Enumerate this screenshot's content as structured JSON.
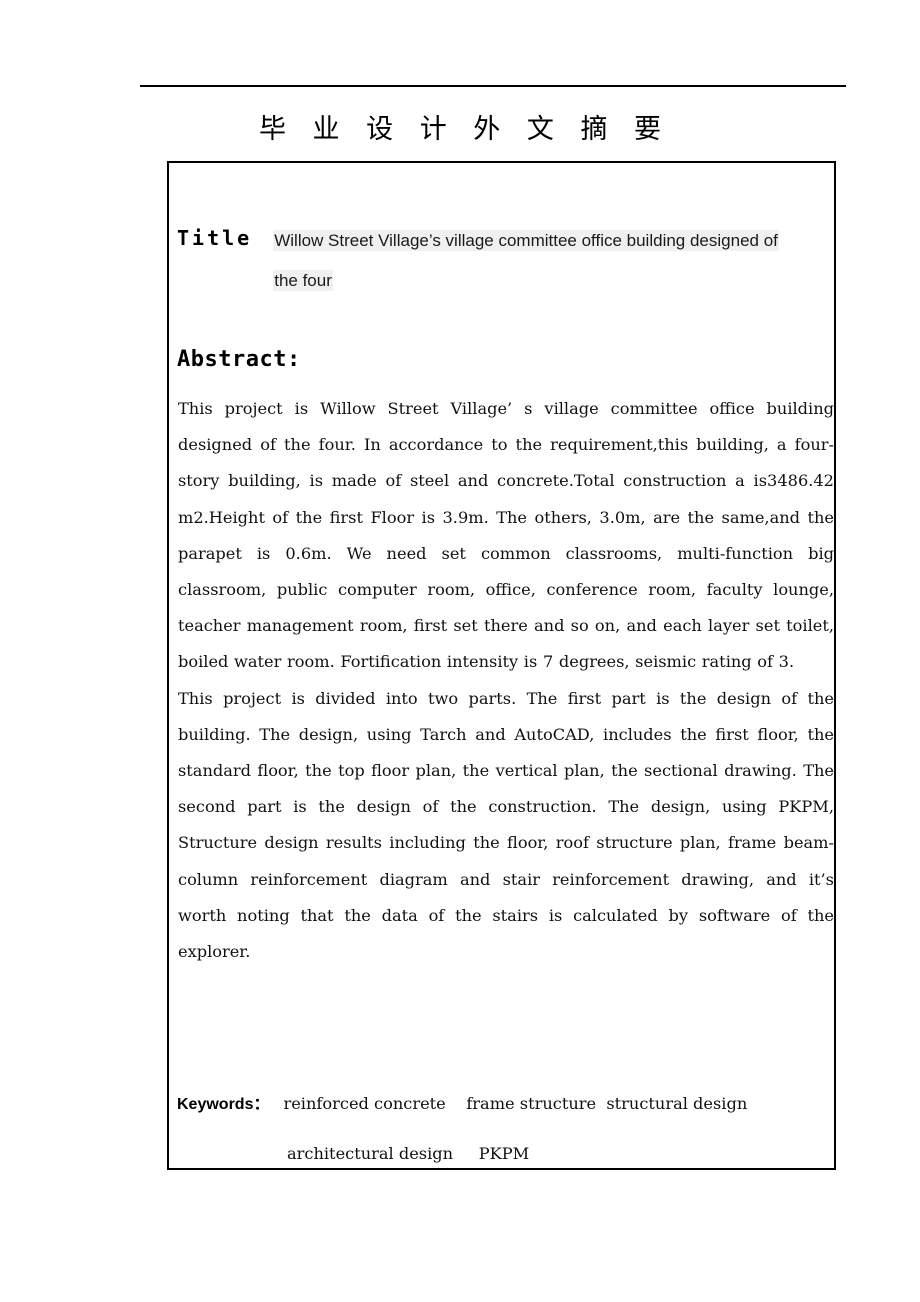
{
  "document": {
    "page_title": "毕 业 设 计 外 文 摘 要",
    "header_rule": "horizontal-rule"
  },
  "title_section": {
    "label": "Title",
    "value_line1": "Willow Street Village’s village committee office building designed of",
    "value_line2": "the four",
    "shading_color": "#f0f0f0"
  },
  "abstract_section": {
    "heading": "Abstract:",
    "paragraph_1": "This project is Willow Street Village’ s village committee office building designed of the four. In accordance to the requirement,this building, a four-story building, is made of steel and concrete.Total construction a is3486.42 m2.Height of the first Floor is 3.9m. The others, 3.0m, are the same,and the parapet is 0.6m. We need set common classrooms, multi-function big classroom, public computer room, office, conference room, faculty lounge, teacher management room, first set there and so on, and each layer set toilet, boiled water room. Fortification intensity is 7 degrees, seismic rating of 3.",
    "paragraph_2": "This project is divided into two parts. The first part is the design of the building. The design, using Tarch and AutoCAD, includes the first floor, the standard floor, the top floor plan, the vertical plan, the sectional drawing. The second part is the design of the construction. The design, using PKPM, Structure design results including the floor, roof structure plan, frame beam-column reinforcement diagram and stair reinforcement drawing, and it’s worth noting that the data of the stairs is calculated by software of the explorer."
  },
  "keywords_section": {
    "label": "Keywords：",
    "line1_terms": "reinforced concrete    frame structure  structural design",
    "line2_terms": "architectural design     PKPM"
  }
}
